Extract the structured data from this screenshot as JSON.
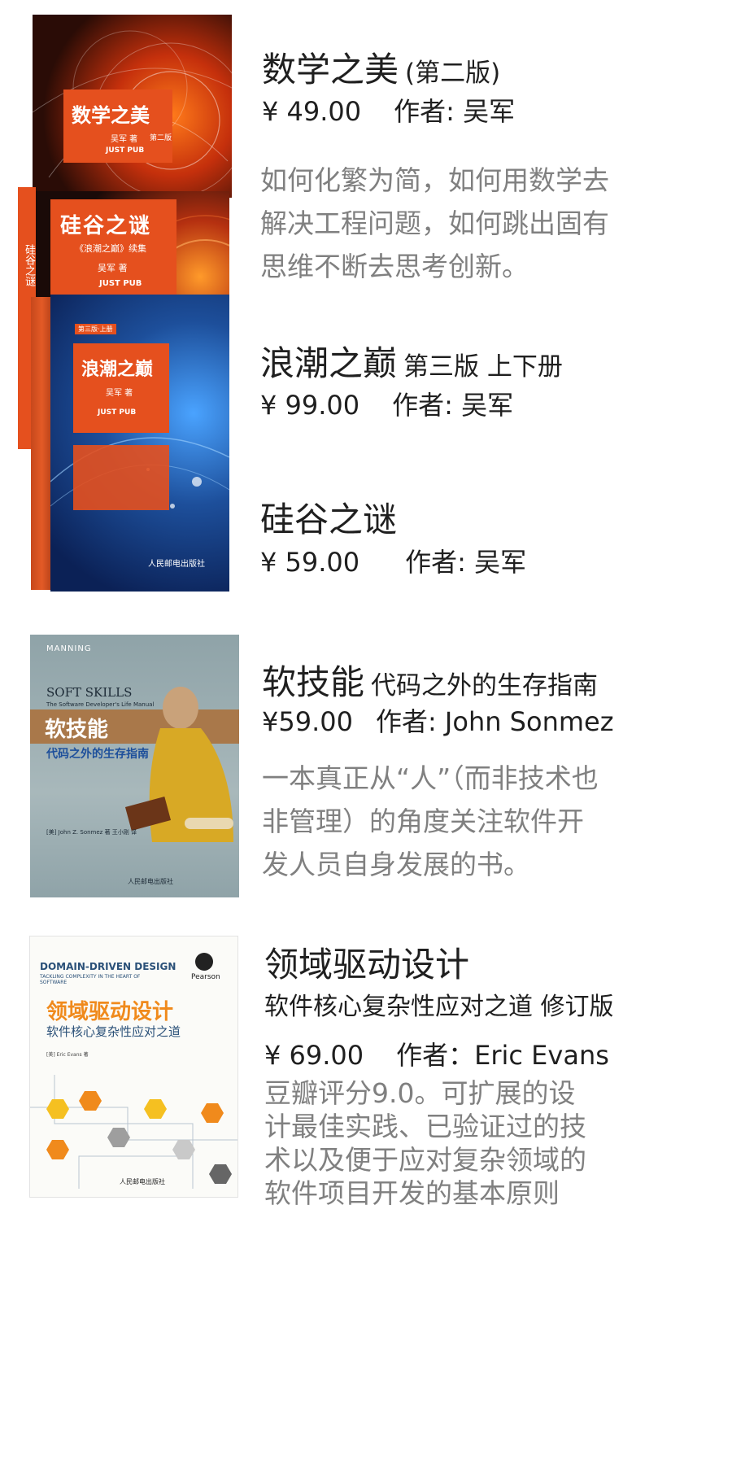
{
  "colors": {
    "title": "#1f1f1f",
    "description": "#808080",
    "cover_orange": "#e5501e",
    "cover_blue": "#1d4f9b",
    "cover_gray": "#8fa3a8",
    "ddd_orange": "#f08a1c"
  },
  "books": [
    {
      "title": "数学之美",
      "subtitle": "(第二版)",
      "price": "¥ 49.00",
      "author": "作者: 吴军",
      "description": "如何化繁为简，如何用数学去解决工程问题，如何跳出固有思维不断去思考创新。",
      "cover": {
        "title": "数学之美",
        "author": "吴军 著",
        "edition": "第二版",
        "publisher_mark": "JUST PUB"
      }
    },
    {
      "title": "浪潮之巅",
      "subtitle": "第三版 上下册",
      "price": "¥ 99.00",
      "author": "作者: 吴军",
      "description": "",
      "cover": {
        "title": "浪潮之巅",
        "author": "吴军 著",
        "edition": "第三版·上册",
        "publisher_mark": "JUST PUB",
        "publisher": "人民邮电出版社"
      }
    },
    {
      "title": "硅谷之谜",
      "subtitle": "",
      "price": "¥ 59.00",
      "author": "作者: 吴军",
      "description": "",
      "cover": {
        "title": "硅谷之谜",
        "series": "《浪潮之巅》续集",
        "author": "吴军 著",
        "publisher_mark": "JUST PUB",
        "spine": "硅谷之谜"
      }
    },
    {
      "title": "软技能",
      "subtitle": "代码之外的生存指南",
      "price": "¥59.00",
      "author": "作者: John Sonmez",
      "description": "一本真正从“人”（而非技术也非管理）的角度关注软件开发人员自身发展的书。",
      "cover": {
        "publisher": "MANNING",
        "en_title": "SOFT SKILLS",
        "en_sub": "The Software Developer's Life Manual",
        "title": "软技能",
        "subtitle": "代码之外的生存指南",
        "author": "[美] John Z. Sonmez 著   王小刚 译",
        "imprint": "人民邮电出版社"
      }
    },
    {
      "title": "领域驱动设计",
      "subtitle": "软件核心复杂性应对之道 修订版",
      "price": "¥ 69.00",
      "author": "作者：Eric Evans",
      "description": "豆瓣评分9.0。可扩展的设计最佳实践、已验证过的技术以及便于应对复杂领域的软件项目开发的基本原则",
      "cover": {
        "en_title": "DOMAIN-DRIVEN DESIGN",
        "en_sub": "TACKLING COMPLEXITY IN THE HEART OF SOFTWARE",
        "title": "领域驱动设计",
        "subtitle": "软件核心复杂性应对之道",
        "author": "[美] Eric Evans 著",
        "publisher": "Pearson",
        "imprint": "人民邮电出版社"
      }
    }
  ]
}
